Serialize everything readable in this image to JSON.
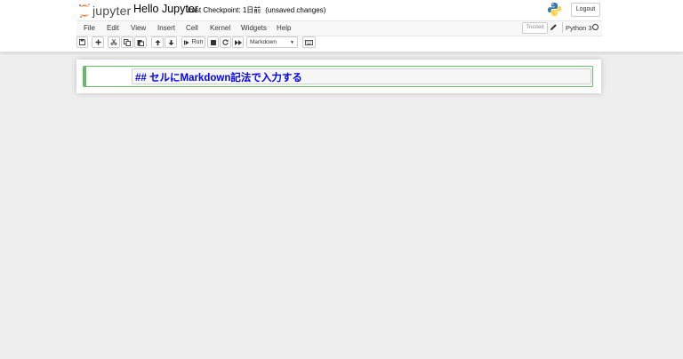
{
  "header": {
    "logo_text": "jupyter",
    "notebook_title": "Hello Jupyter",
    "checkpoint_label": "Last Checkpoint: 1日前",
    "checkpoint_status": "(unsaved changes)",
    "logout_label": "Logout"
  },
  "menu": {
    "items": [
      "File",
      "Edit",
      "View",
      "Insert",
      "Cell",
      "Kernel",
      "Widgets",
      "Help"
    ],
    "trusted_label": "Trusted",
    "kernel_name": "Python 3"
  },
  "toolbar": {
    "run_label": "Run",
    "cell_type": "Markdown",
    "icons": [
      "save-icon",
      "plus-icon",
      "scissors-icon",
      "copy-icon",
      "paste-icon",
      "arrow-up-icon",
      "arrow-down-icon",
      "step-forward-icon",
      "stop-icon",
      "refresh-icon",
      "fast-forward-icon",
      "keyboard-icon"
    ]
  },
  "cell": {
    "source": "## セルにMarkdown記法で入力する"
  },
  "colors": {
    "accent_orange": "#f37726",
    "cell_border_green": "#66bb6a",
    "markdown_heading_blue": "#0000ff",
    "background": "#eeeeee"
  }
}
